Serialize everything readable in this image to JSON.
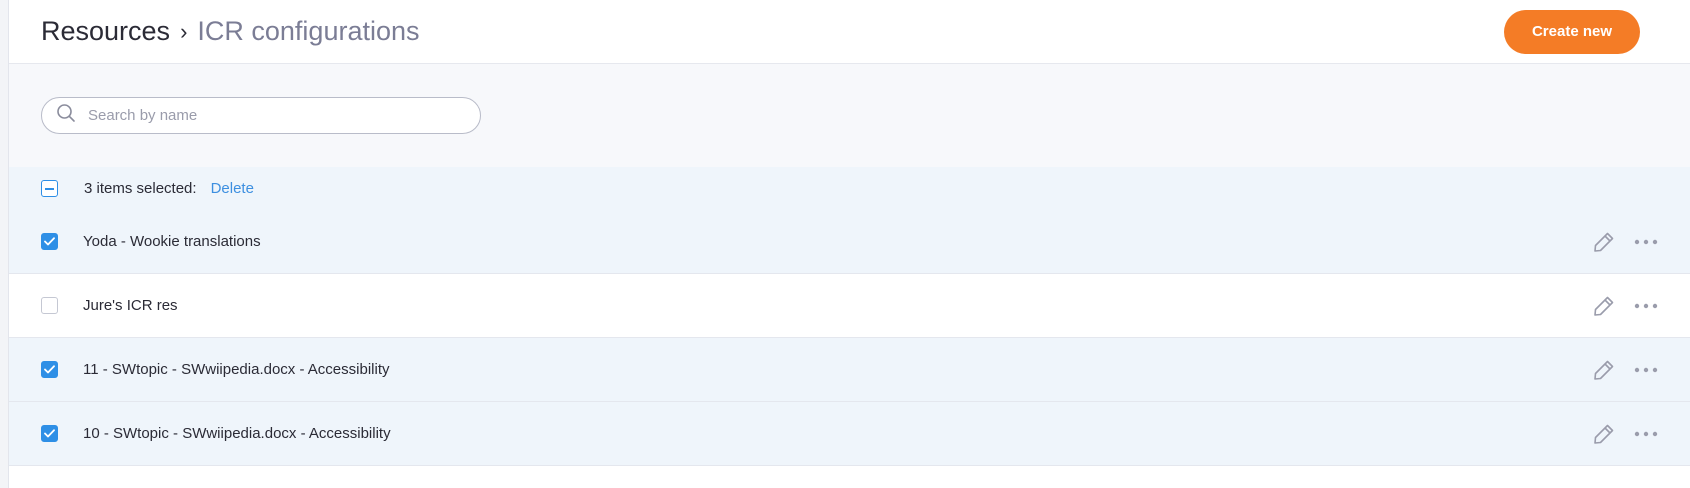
{
  "header": {
    "breadcrumb_root": "Resources",
    "breadcrumb_separator": "›",
    "breadcrumb_current": "ICR configurations",
    "create_button_label": "Create new"
  },
  "search": {
    "placeholder": "Search by name",
    "value": ""
  },
  "selection": {
    "count_text": "3 items selected:",
    "delete_label": "Delete",
    "state": "partial"
  },
  "rows": [
    {
      "name": "Yoda - Wookie translations",
      "checked": true
    },
    {
      "name": "Jure's ICR res",
      "checked": false
    },
    {
      "name": "11 - SWtopic - SWwiipedia.docx - Accessibility",
      "checked": true
    },
    {
      "name": "10 - SWtopic - SWwiipedia.docx - Accessibility",
      "checked": true
    }
  ],
  "icons": {
    "search": "search-icon",
    "edit": "pencil-icon",
    "more": "more-horizontal-icon",
    "check": "checkmark-icon"
  },
  "colors": {
    "accent": "#f47c26",
    "link": "#3d8fe0",
    "checkbox": "#2e8fe6",
    "selected_row": "#eff5fb"
  }
}
